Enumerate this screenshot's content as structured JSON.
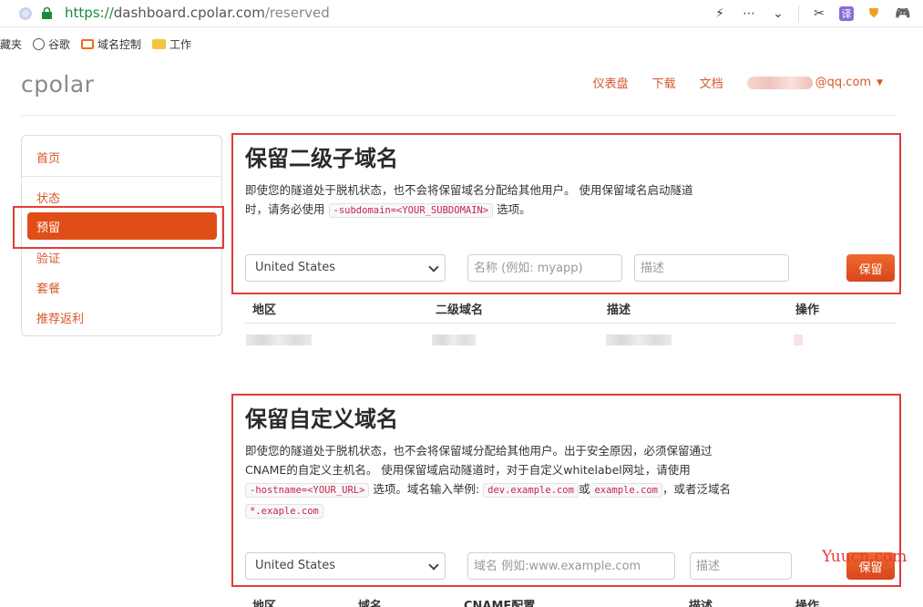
{
  "browser": {
    "url_scheme": "https://",
    "url_host": "dashboard.cpolar.com",
    "url_path": "/reserved",
    "translate_label": "译",
    "bookmarks": [
      {
        "label": "藏夹",
        "icon": "none"
      },
      {
        "label": "谷歌",
        "icon": "globe-icon"
      },
      {
        "label": "域名控制",
        "icon": "cpolar-bookmark-icon"
      },
      {
        "label": "工作",
        "icon": "folder-icon"
      }
    ]
  },
  "header": {
    "logo": "cpolar",
    "nav": [
      "仪表盘",
      "下载",
      "文档"
    ],
    "user_suffix": "@qq.com"
  },
  "sidebar": {
    "items": [
      "首页",
      "状态",
      "预留",
      "验证",
      "套餐",
      "推荐返利"
    ],
    "active": "预留"
  },
  "subdomain_section": {
    "title": "保留二级子域名",
    "desc_line1": "即使您的隧道处于脱机状态，也不会将保留域名分配给其他用户。 使用保留域名启动隧道",
    "desc_line2_pre": "时，请务必使用",
    "desc_code": "-subdomain=<YOUR_SUBDOMAIN>",
    "desc_line2_post": "选项。",
    "region_value": "United States",
    "name_placeholder": "名称 (例如: myapp)",
    "desc_placeholder": "描述",
    "save_label": "保留",
    "table_headers": [
      "地区",
      "二级域名",
      "描述",
      "操作"
    ]
  },
  "custom_section": {
    "title": "保留自定义域名",
    "desc_line1": "即使您的隧道处于脱机状态，也不会将保留域分配给其他用户。出于安全原因，必须保留通过",
    "desc_line2": "CNAME的自定义主机名。 使用保留域启动隧道时，对于自定义whitelabel网址，请使用",
    "code_hostname": "-hostname=<YOUR_URL>",
    "desc_line3_mid": "选项。域名输入举例:",
    "code_example1": "dev.example.com",
    "desc_or": "或",
    "code_example2": "example.com",
    "desc_wildcard": "，或者泛域名",
    "code_wildcard": "*.exaple.com",
    "region_value": "United States",
    "domain_placeholder": "域名 例如:www.example.com",
    "desc_placeholder": "描述",
    "save_label": "保留",
    "table_headers": [
      "地区",
      "域名",
      "CNAME配置",
      "描述",
      "操作"
    ]
  },
  "watermark": "Yuucn.com"
}
